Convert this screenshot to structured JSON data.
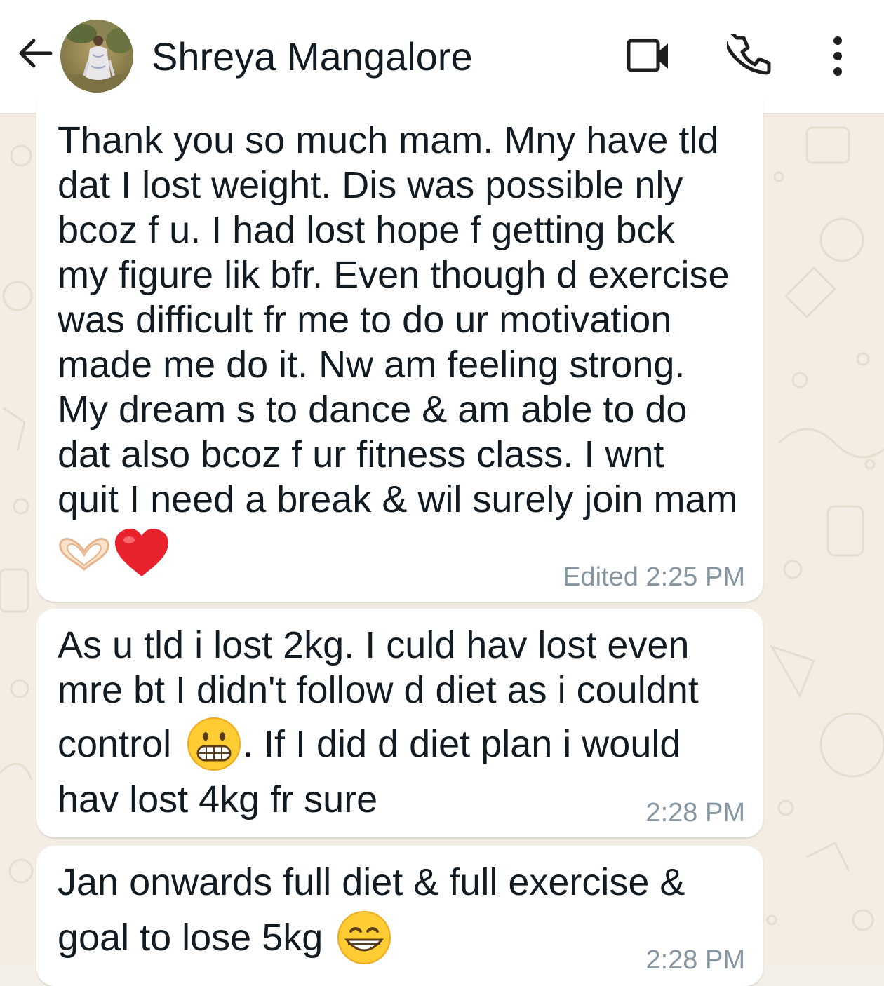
{
  "header": {
    "contact_name": "Shreya Mangalore",
    "back_icon": "arrow-left-icon",
    "video_icon": "video-camera-icon",
    "call_icon": "phone-icon",
    "menu_icon": "more-vertical-icon"
  },
  "messages": [
    {
      "lines": [
        "Thank you so much mam. Mny have tld",
        "dat I lost weight. Dis was possible nly",
        "bcoz f u. I had lost hope f getting bck",
        "my figure lik bfr. Even though d exercise",
        "was difficult fr me to do ur motivation",
        "made me do it. Nw am feeling strong.",
        "My dream s to dance & am able to do",
        "dat also bcoz f ur fitness class. I wnt",
        "quit I need a break & wil surely join mam"
      ],
      "emojis": [
        "heart-hands-emoji",
        "red-heart-emoji"
      ],
      "timestamp": "Edited 2:25 PM"
    },
    {
      "lines": [
        "As u tld i lost 2kg. I culd hav lost even",
        "mre bt I didn't follow d diet as i couldnt",
        "control",
        ". If I did d diet plan i would",
        "hav lost 4kg fr sure"
      ],
      "emojis": [
        "grimacing-face-emoji"
      ],
      "timestamp": "2:28 PM"
    },
    {
      "lines": [
        "Jan onwards full diet & full exercise &",
        "goal to lose 5kg"
      ],
      "emojis": [
        "grinning-face-emoji"
      ],
      "timestamp": "2:28 PM"
    }
  ],
  "colors": {
    "header_bg": "#ffffff",
    "wallpaper_bg": "#f3ede3",
    "bubble_bg": "#ffffff",
    "text": "#111b21",
    "timestamp": "#8696a0"
  }
}
